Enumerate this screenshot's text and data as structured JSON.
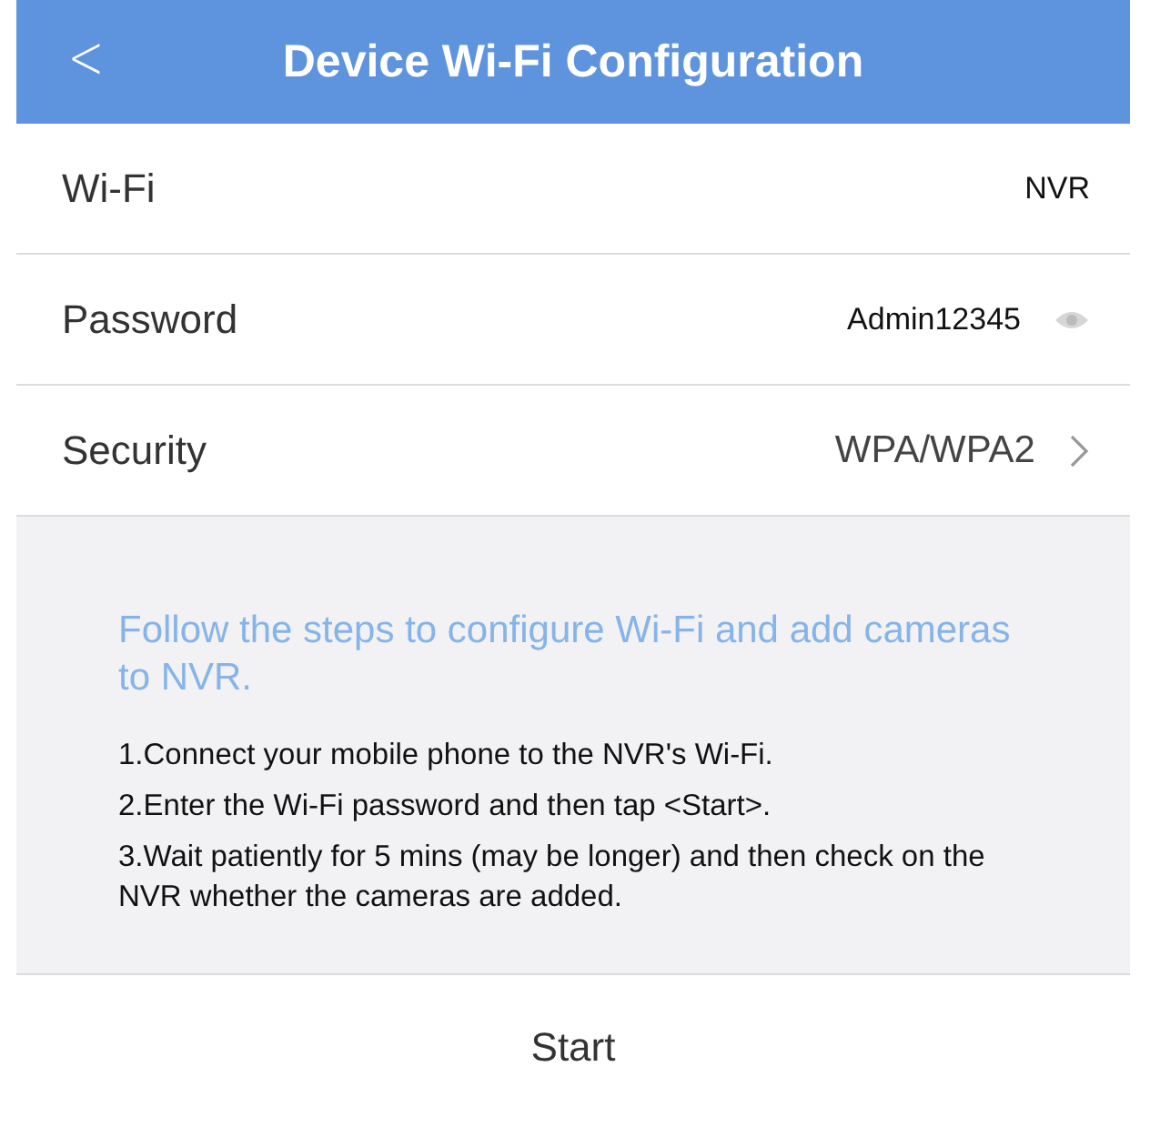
{
  "header": {
    "back": "<",
    "title": "Device Wi-Fi Configuration"
  },
  "fields": [
    {
      "kind": "text",
      "label": "Wi-Fi",
      "value": "NVR"
    },
    {
      "kind": "password",
      "label": "Password",
      "value": "Admin12345"
    },
    {
      "kind": "select",
      "label": "Security",
      "value": "WPA/WPA2"
    }
  ],
  "instructions": {
    "headline": "Follow the steps to configure Wi-Fi and add cameras to NVR.",
    "steps": [
      "1.Connect your mobile phone to the NVR's Wi-Fi.",
      "2.Enter the Wi-Fi password and then tap <Start>.",
      "3.Wait patiently for 5 mins (may be longer) and then check on the NVR whether the cameras are added."
    ]
  },
  "start_button": "Start"
}
